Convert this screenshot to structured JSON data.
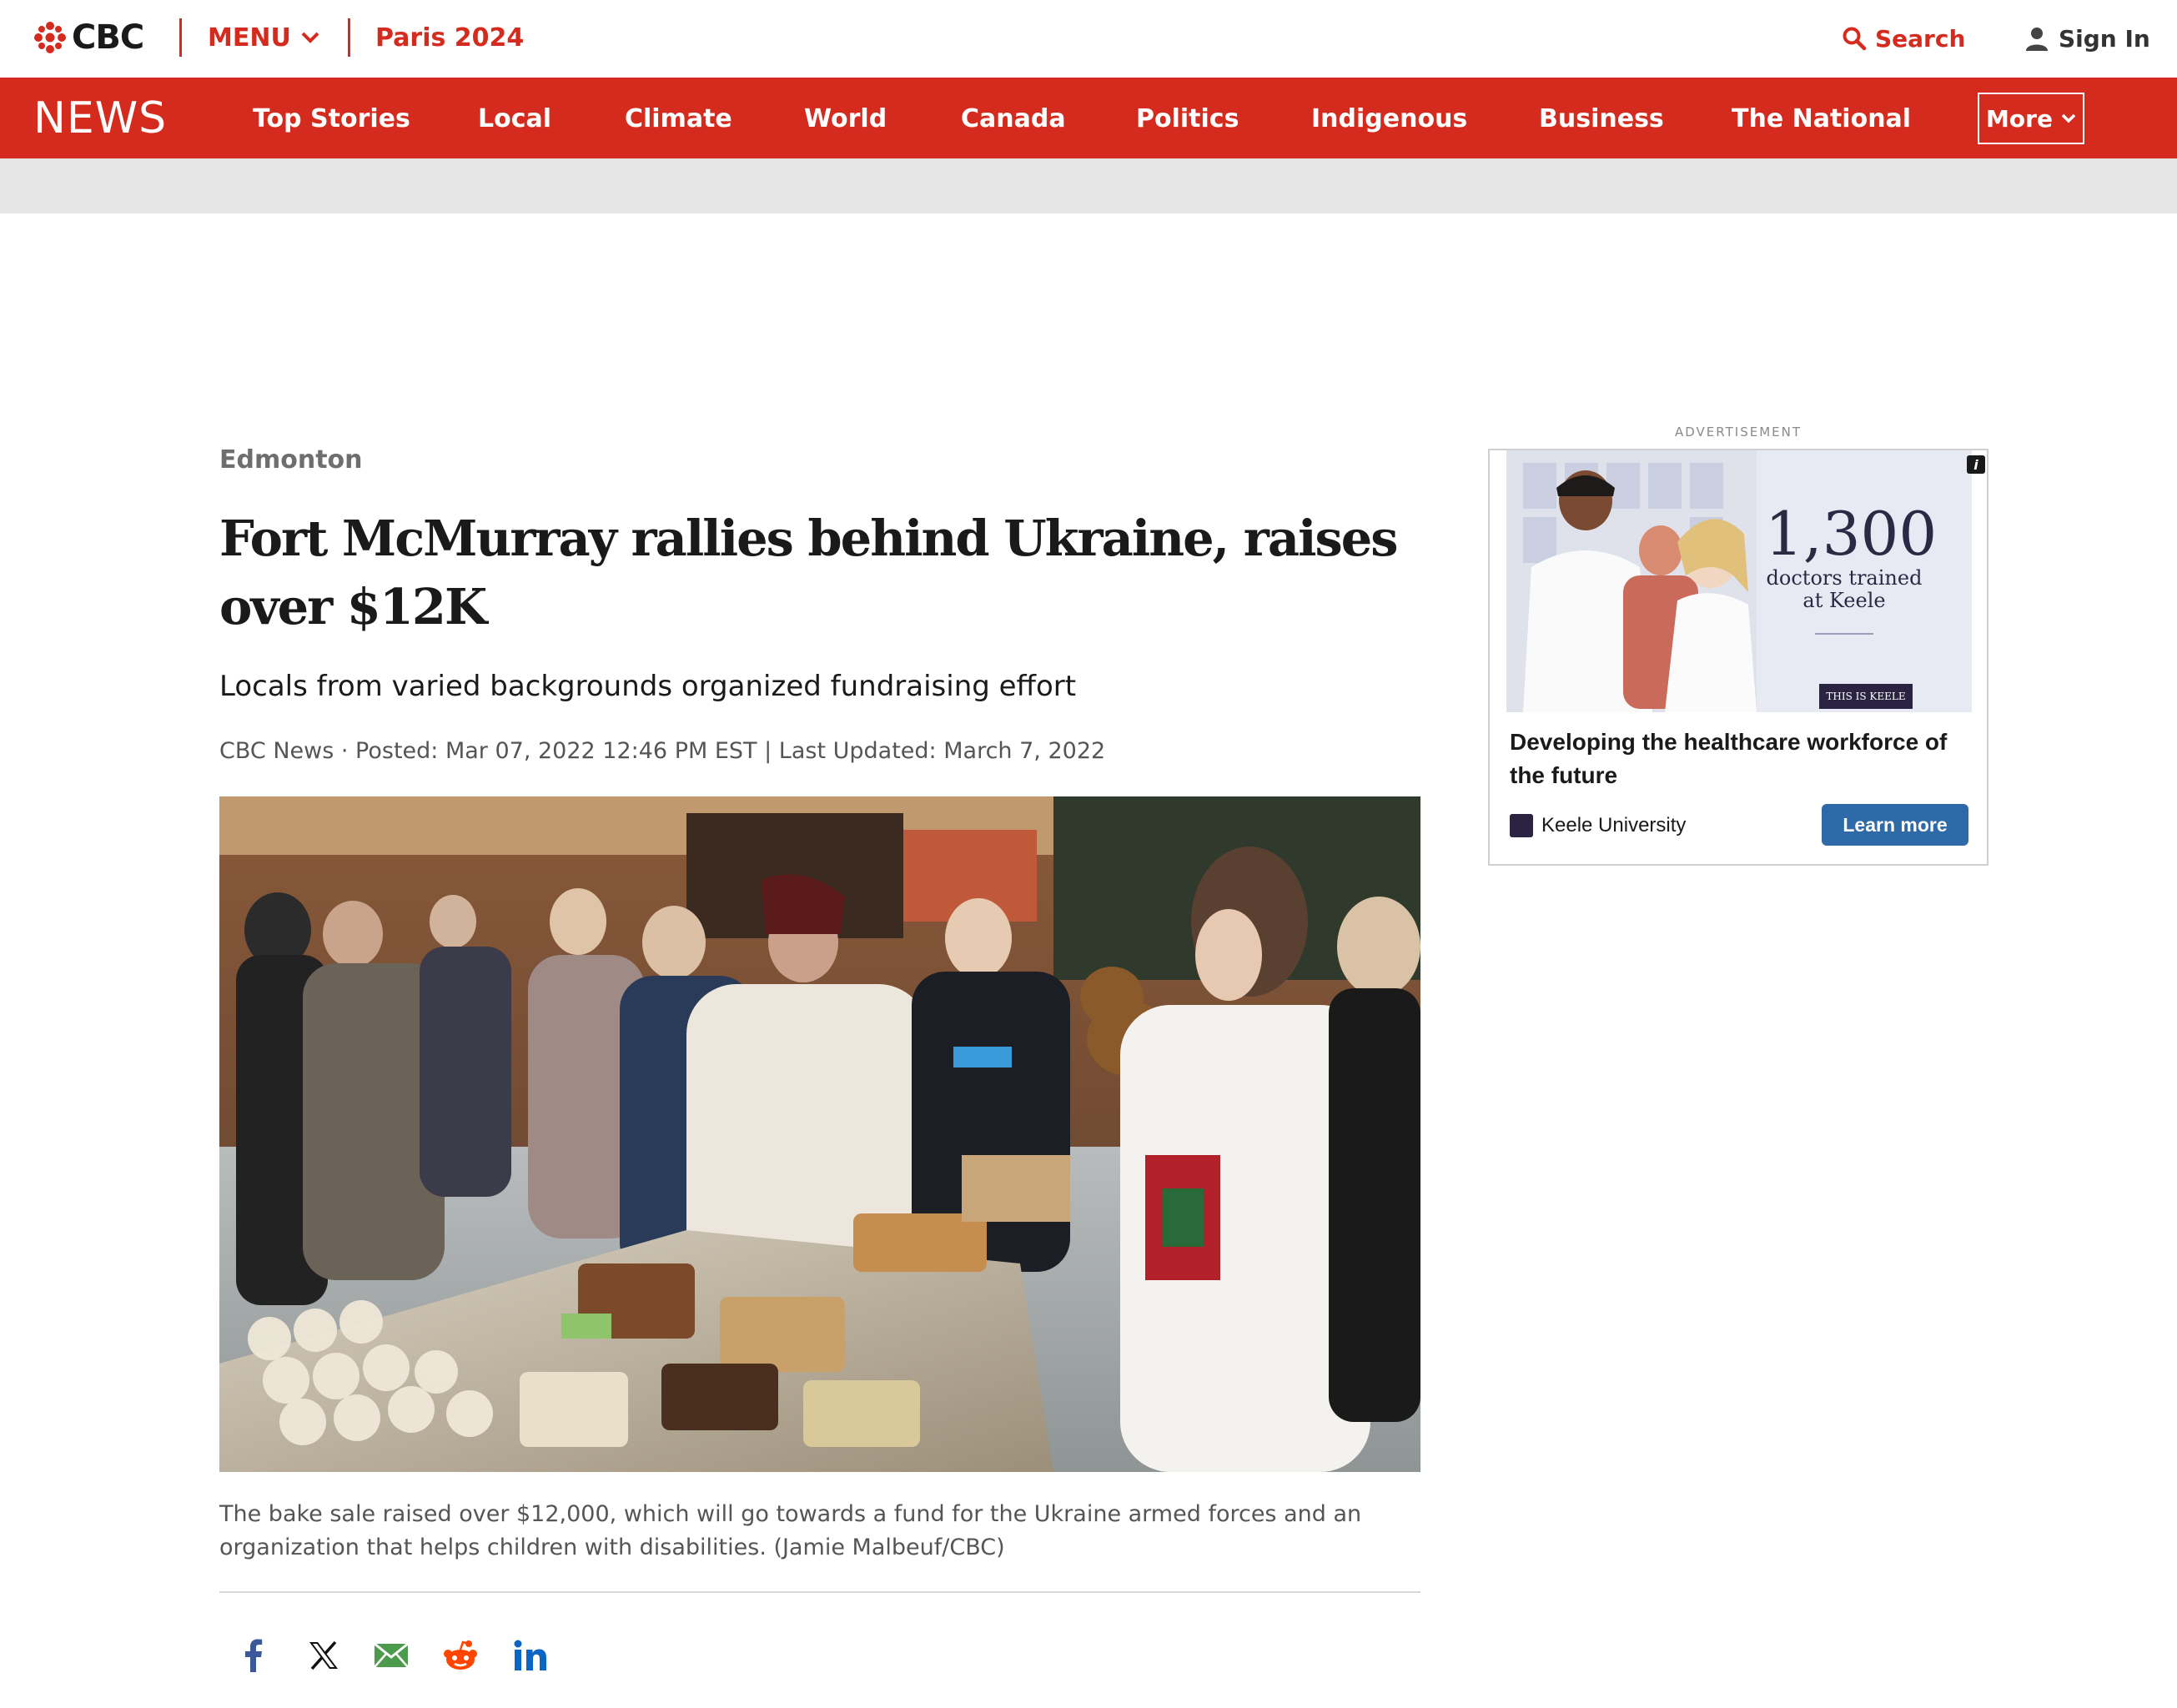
{
  "header": {
    "logo_text": "CBC",
    "menu_label": "MENU",
    "paris_label": "Paris 2024",
    "search_label": "Search",
    "signin_label": "Sign In"
  },
  "nav": {
    "news_label": "NEWS",
    "items": [
      {
        "label": "Top Stories"
      },
      {
        "label": "Local"
      },
      {
        "label": "Climate"
      },
      {
        "label": "World"
      },
      {
        "label": "Canada"
      },
      {
        "label": "Politics"
      },
      {
        "label": "Indigenous"
      },
      {
        "label": "Business"
      },
      {
        "label": "The National"
      }
    ],
    "more_label": "More"
  },
  "article": {
    "section": "Edmonton",
    "headline": "Fort McMurray rallies behind Ukraine, raises over $12K",
    "deck": "Locals from varied backgrounds organized fundraising effort",
    "byline": "CBC News · Posted: Mar 07, 2022 12:46 PM EST | Last Updated: March 7, 2022",
    "caption": "The bake sale raised over $12,000, which will go towards a fund for the Ukraine armed forces and an organization that helps children with disabilities. (Jamie Malbeuf/CBC)"
  },
  "share": [
    {
      "name": "facebook-icon"
    },
    {
      "name": "x-icon"
    },
    {
      "name": "email-icon"
    },
    {
      "name": "reddit-icon"
    },
    {
      "name": "linkedin-icon"
    }
  ],
  "ad": {
    "label": "ADVERTISEMENT",
    "stat_number": "1,300",
    "stat_line1": "doctors trained",
    "stat_line2": "at Keele",
    "badge": "THIS IS KEELE",
    "headline": "Developing the healthcare workforce of the future",
    "brand": "Keele University",
    "cta": "Learn more"
  },
  "colors": {
    "brand_red": "#d52b1e",
    "ad_cta_blue": "#2e6aa8"
  }
}
